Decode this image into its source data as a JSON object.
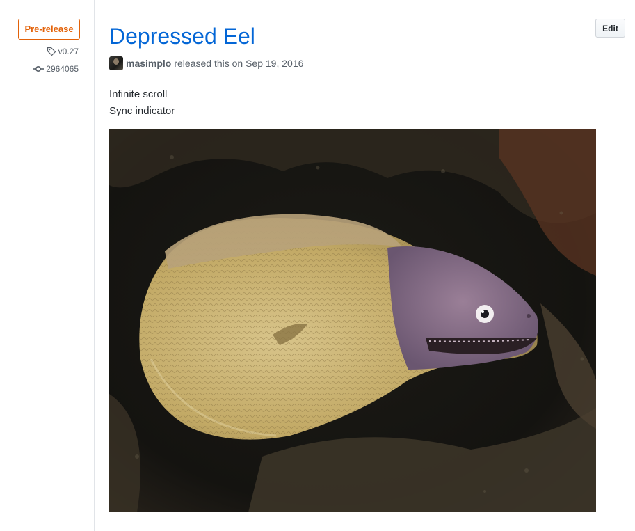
{
  "sidebar": {
    "badge_label": "Pre-release",
    "tag": "v0.27",
    "commit": "2964065"
  },
  "release": {
    "title": "Depressed Eel",
    "edit_label": "Edit",
    "author": "masimplo",
    "byline_text": "released this on Sep 19, 2016",
    "notes": [
      "Infinite scroll",
      "Sync indicator"
    ]
  },
  "colors": {
    "title": "#0366d6",
    "prerelease": "#e36209"
  },
  "icons": {
    "tag": "tag-icon",
    "commit": "git-commit-icon"
  }
}
